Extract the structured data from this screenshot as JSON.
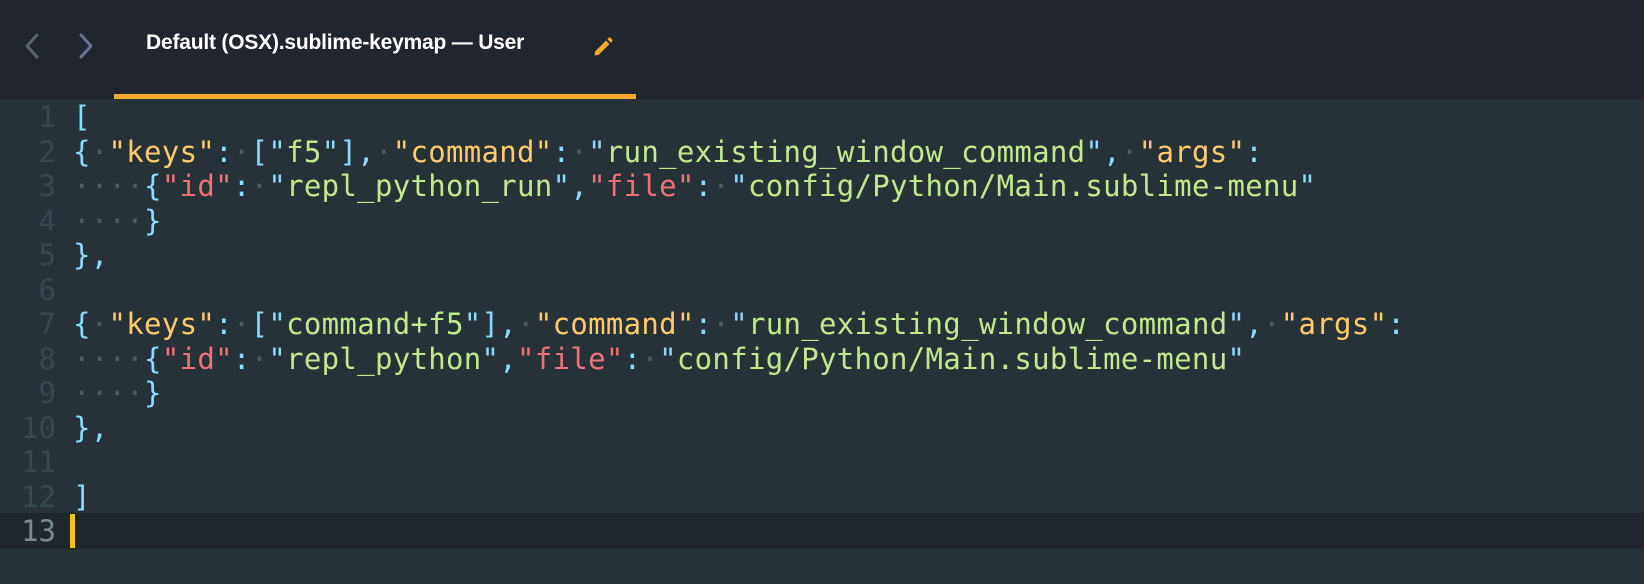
{
  "window": {
    "background": "#263238",
    "tabbar_background": "#21252e",
    "accent": "#f2a92c"
  },
  "nav": {
    "back_icon": "chevron-left-icon",
    "forward_icon": "chevron-right-icon"
  },
  "tab": {
    "title": "Default (OSX).sublime-keymap — User",
    "edit_icon": "pencil-icon"
  },
  "editor": {
    "line_numbers": [
      "1",
      "2",
      "3",
      "4",
      "5",
      "6",
      "7",
      "8",
      "9",
      "10",
      "11",
      "12",
      "13"
    ],
    "active_line": 13,
    "syntax_colors": {
      "punctuation": "#89ddff",
      "key": "#ffcb6b",
      "inner_key": "#f07178",
      "string": "#c3e88d",
      "whitespace_dot": "#495a61"
    },
    "lines": [
      [
        {
          "t": "[",
          "c": "p"
        }
      ],
      [
        {
          "t": "{",
          "c": "p"
        },
        {
          "t": "·",
          "c": "ws"
        },
        {
          "t": "\"keys\"",
          "c": "k"
        },
        {
          "t": ":",
          "c": "p"
        },
        {
          "t": "·",
          "c": "ws"
        },
        {
          "t": "[\"",
          "c": "p"
        },
        {
          "t": "f5",
          "c": "s"
        },
        {
          "t": "\"],",
          "c": "p"
        },
        {
          "t": "·",
          "c": "ws"
        },
        {
          "t": "\"command\"",
          "c": "k"
        },
        {
          "t": ":",
          "c": "p"
        },
        {
          "t": "·",
          "c": "ws"
        },
        {
          "t": "\"",
          "c": "p"
        },
        {
          "t": "run_existing_window_command",
          "c": "s"
        },
        {
          "t": "\",",
          "c": "p"
        },
        {
          "t": "·",
          "c": "ws"
        },
        {
          "t": "\"args\"",
          "c": "k"
        },
        {
          "t": ":",
          "c": "p"
        }
      ],
      [
        {
          "t": "····",
          "c": "ws"
        },
        {
          "t": "{",
          "c": "p"
        },
        {
          "t": "\"id\"",
          "c": "a"
        },
        {
          "t": ":",
          "c": "p"
        },
        {
          "t": "·",
          "c": "ws"
        },
        {
          "t": "\"",
          "c": "p"
        },
        {
          "t": "repl_python_run",
          "c": "s"
        },
        {
          "t": "\",",
          "c": "p"
        },
        {
          "t": "\"file\"",
          "c": "a"
        },
        {
          "t": ":",
          "c": "p"
        },
        {
          "t": "·",
          "c": "ws"
        },
        {
          "t": "\"",
          "c": "p"
        },
        {
          "t": "config/Python/Main.sublime-menu",
          "c": "s"
        },
        {
          "t": "\"",
          "c": "p"
        }
      ],
      [
        {
          "t": "····",
          "c": "ws"
        },
        {
          "t": "}",
          "c": "p"
        }
      ],
      [
        {
          "t": "},",
          "c": "p"
        }
      ],
      [],
      [
        {
          "t": "{",
          "c": "p"
        },
        {
          "t": "·",
          "c": "ws"
        },
        {
          "t": "\"keys\"",
          "c": "k"
        },
        {
          "t": ":",
          "c": "p"
        },
        {
          "t": "·",
          "c": "ws"
        },
        {
          "t": "[\"",
          "c": "p"
        },
        {
          "t": "command+f5",
          "c": "s"
        },
        {
          "t": "\"],",
          "c": "p"
        },
        {
          "t": "·",
          "c": "ws"
        },
        {
          "t": "\"command\"",
          "c": "k"
        },
        {
          "t": ":",
          "c": "p"
        },
        {
          "t": "·",
          "c": "ws"
        },
        {
          "t": "\"",
          "c": "p"
        },
        {
          "t": "run_existing_window_command",
          "c": "s"
        },
        {
          "t": "\",",
          "c": "p"
        },
        {
          "t": "·",
          "c": "ws"
        },
        {
          "t": "\"args\"",
          "c": "k"
        },
        {
          "t": ":",
          "c": "p"
        }
      ],
      [
        {
          "t": "····",
          "c": "ws"
        },
        {
          "t": "{",
          "c": "p"
        },
        {
          "t": "\"id\"",
          "c": "a"
        },
        {
          "t": ":",
          "c": "p"
        },
        {
          "t": "·",
          "c": "ws"
        },
        {
          "t": "\"",
          "c": "p"
        },
        {
          "t": "repl_python",
          "c": "s"
        },
        {
          "t": "\",",
          "c": "p"
        },
        {
          "t": "\"file\"",
          "c": "a"
        },
        {
          "t": ":",
          "c": "p"
        },
        {
          "t": "·",
          "c": "ws"
        },
        {
          "t": "\"",
          "c": "p"
        },
        {
          "t": "config/Python/Main.sublime-menu",
          "c": "s"
        },
        {
          "t": "\"",
          "c": "p"
        }
      ],
      [
        {
          "t": "····",
          "c": "ws"
        },
        {
          "t": "}",
          "c": "p"
        }
      ],
      [
        {
          "t": "},",
          "c": "p"
        }
      ],
      [],
      [
        {
          "t": "]",
          "c": "p"
        }
      ],
      []
    ]
  }
}
